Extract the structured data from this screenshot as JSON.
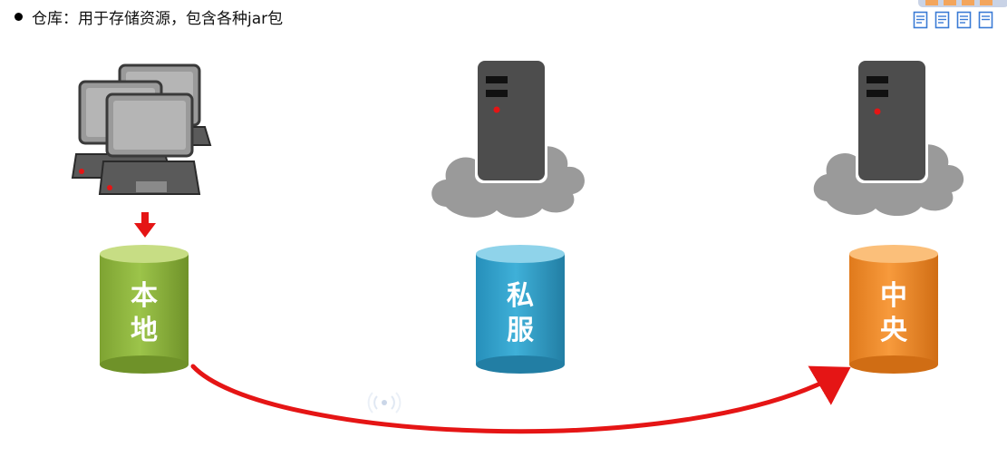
{
  "bullet": {
    "text": "仓库：用于存储资源，包含各种jar包"
  },
  "repositories": [
    {
      "id": "local",
      "chars": [
        "本",
        "地"
      ],
      "color_top": "#c7dd84",
      "color_body": "#8cb33a",
      "color_dark": "#6f9229"
    },
    {
      "id": "private",
      "chars": [
        "私",
        "服"
      ],
      "color_top": "#8fd3ea",
      "color_body": "#2f9fca",
      "color_dark": "#227ea4"
    },
    {
      "id": "central",
      "chars": [
        "中",
        "央"
      ],
      "color_top": "#fbbf7a",
      "color_body": "#f08a26",
      "color_dark": "#d06d14"
    }
  ],
  "colors": {
    "arrow": "#e51515",
    "server": "#4d4d4d",
    "cloud": "#9a9a9a",
    "computer": "#8a8a8a",
    "tool_icon": "#3a7bd5"
  },
  "icons": {
    "computers": "desktop-computers-icon",
    "server": "server-tower-icon",
    "cloud": "cloud-icon",
    "document": "document-icon"
  }
}
